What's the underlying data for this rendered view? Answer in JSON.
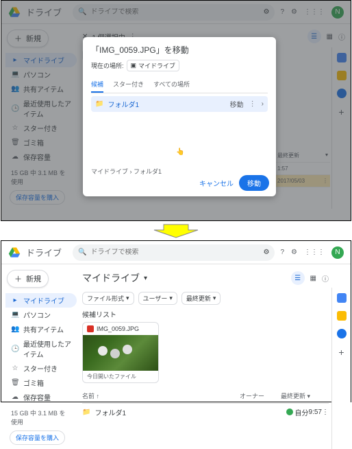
{
  "brand": "ドライブ",
  "search_placeholder": "ドライブで検索",
  "avatar": "N",
  "new_btn": "新規",
  "sidebar": {
    "items": [
      {
        "icon": "▸",
        "label": "マイドライブ"
      },
      {
        "icon": "💻",
        "label": "パソコン"
      },
      {
        "icon": "👥",
        "label": "共有アイテム"
      },
      {
        "icon": "🕒",
        "label": "最近使用したアイテム"
      },
      {
        "icon": "☆",
        "label": "スター付き"
      },
      {
        "icon": "🗑",
        "label": "ゴミ箱"
      },
      {
        "icon": "☁",
        "label": "保存容量"
      }
    ]
  },
  "storage": "15 GB 中 3.1 MB を使用",
  "buy": "保存容量を購入",
  "top": {
    "selected": "1 個選択中",
    "chips": [
      "ファイル形式",
      "ユーザー",
      "最終更新"
    ],
    "modal": {
      "title": "「IMG_0059.JPG」を移動",
      "loc_label": "現在の場所:",
      "loc_value": "マイドライブ",
      "tabs": [
        "候補",
        "スター付き",
        "すべての場所"
      ],
      "folder": "フォルダ1",
      "move_badge": "移動",
      "breadcrumb": "マイドライブ  ›  フォルダ1",
      "cancel": "キャンセル",
      "move": "移動"
    },
    "peek": [
      {
        "a": "最終更新",
        "b": ""
      },
      {
        "a": "1:57",
        "b": ""
      },
      {
        "a": "2017/05/03",
        "b": ""
      }
    ]
  },
  "bottom": {
    "title": "マイドライブ",
    "chips": [
      "ファイル形式",
      "ユーザー",
      "最終更新"
    ],
    "sugg": "候補リスト",
    "card": {
      "name": "IMG_0059.JPG",
      "footer": "今日開いたファイル"
    },
    "table": {
      "h1": "名前",
      "h2": "オーナー",
      "h3": "最終更新",
      "rows": [
        {
          "name": "フォルダ1",
          "owner": "自分",
          "date": "9:57"
        }
      ]
    }
  }
}
